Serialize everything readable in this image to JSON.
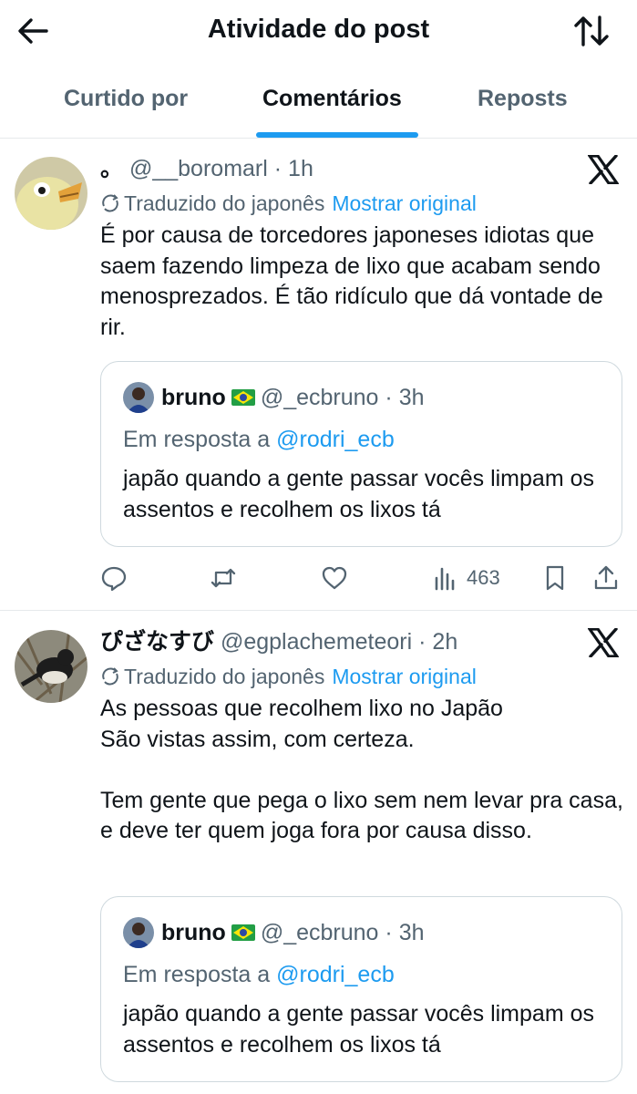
{
  "header": {
    "title": "Atividade do post",
    "back_icon": "arrow-left-icon",
    "sort_icon": "sort-arrows-icon"
  },
  "tabs": [
    {
      "label": "Curtido por",
      "active": false
    },
    {
      "label": "Comentários",
      "active": true
    },
    {
      "label": "Reposts",
      "active": false
    }
  ],
  "colors": {
    "accent": "#1d9bf0",
    "text": "#0f1419",
    "secondary": "#536471",
    "divider": "#e6e9eb"
  },
  "posts": [
    {
      "name": "。",
      "handle": "@__boromarl",
      "time": "· 1h",
      "translated_label": "Traduzido do japonês",
      "show_original": "Mostrar original",
      "text": "É por causa de torcedores japoneses idiotas que saem fazendo limpeza de lixo que acabam sendo menosprezados. É tão ridículo que dá vontade de rir.",
      "quote": {
        "name": "bruno",
        "flag": "brazil-flag-icon",
        "handle": "@_ecbruno",
        "time": "· 3h",
        "reply_prefix": "Em resposta a",
        "reply_mention": "@rodri_ecb",
        "text": "japão quando a gente passar vocês limpam os assentos e recolhem os lixos tá"
      },
      "views": "463"
    },
    {
      "name": "ぴざなすび",
      "handle": "@egplachemeteori",
      "time": "· 2h",
      "translated_label": "Traduzido do japonês",
      "show_original": "Mostrar original",
      "text": "As pessoas que recolhem lixo no Japão\nSão vistas assim, com certeza.\n\nTem gente que pega o lixo sem nem levar pra casa, e deve ter quem joga fora por causa disso.",
      "quote": {
        "name": "bruno",
        "flag": "brazil-flag-icon",
        "handle": "@_ecbruno",
        "time": "· 3h",
        "reply_prefix": "Em resposta a",
        "reply_mention": "@rodri_ecb",
        "text": "japão quando a gente passar vocês limpam os assentos e recolhem os lixos tá"
      }
    }
  ]
}
